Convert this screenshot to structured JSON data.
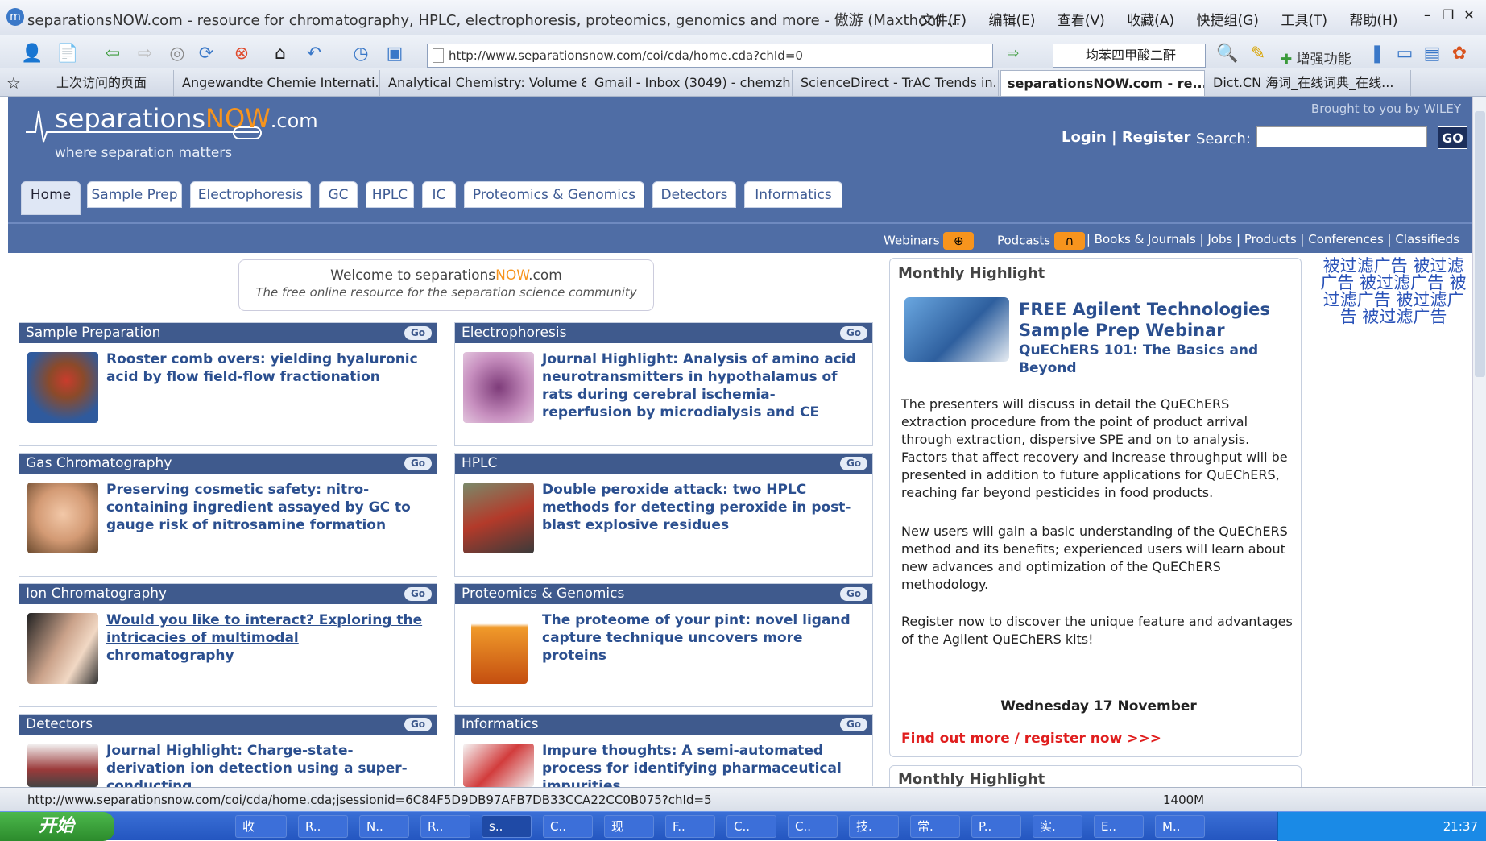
{
  "browser": {
    "title": "separationsNOW.com - resource for chromatography, HPLC, electrophoresis, proteomics, genomics and more - 傲游 (Maxthon) ...",
    "menus": [
      "文件(F)",
      "编辑(E)",
      "查看(V)",
      "收藏(A)",
      "快捷组(G)",
      "工具(T)",
      "帮助(H)"
    ],
    "address": "http://www.separationsnow.com/coi/cda/home.cda?chId=0",
    "search_value": "均苯四甲酸二酐",
    "enhance_label": "增强功能",
    "tabs": [
      "上次访问的页面",
      "Angewandte Chemie Internati...",
      "Analytical Chemistry: Volume 8...",
      "Gmail - Inbox (3049) - chemzh...",
      "ScienceDirect - TrAC Trends in...",
      "separationsNOW.com - re...",
      "Dict.CN 海词_在线词典_在线..."
    ],
    "status_url": "http://www.separationsnow.com/coi/cda/home.cda;jsessionid=6C84F5D9DB97AFB7DB33CCA22CC0B075?chId=5",
    "memory": "1400M"
  },
  "site": {
    "logo_main": "separations",
    "logo_now": "NOW",
    "logo_com": ".com",
    "tagline": "where separation matters",
    "brought": "Brought to you by WILEY",
    "login": "Login | Register",
    "search_label": "Search:",
    "go": "GO",
    "nav": [
      "Home",
      "Sample Prep",
      "Electrophoresis",
      "GC",
      "HPLC",
      "IC",
      "Proteomics & Genomics",
      "Detectors",
      "Informatics"
    ],
    "webinars": "Webinars",
    "podcasts": "Podcasts",
    "sub_links": "| Books & Journals | Jobs | Products | Conferences | Classifieds",
    "welcome_a1": "Welcome to separations",
    "welcome_now": "NOW",
    "welcome_a2": ".com",
    "welcome_b": "The free online resource for the separation science community"
  },
  "boxes": [
    {
      "title": "Sample Preparation",
      "text": "Rooster comb overs: yielding hyaluronic acid by flow field-flow fractionation"
    },
    {
      "title": "Electrophoresis",
      "text": "Journal Highlight: Analysis of amino acid neurotransmitters in hypothalamus of rats during cerebral ischemia-reperfusion by microdialysis and CE"
    },
    {
      "title": "Gas Chromatography",
      "text": "Preserving cosmetic safety: nitro-containing ingredient assayed by GC to gauge risk of nitrosamine formation"
    },
    {
      "title": "HPLC",
      "text": "Double peroxide attack: two HPLC methods for detecting peroxide in post-blast explosive residues"
    },
    {
      "title": "Ion Chromatography",
      "text": "Would you like to interact? Exploring the intricacies of multimodal chromatography"
    },
    {
      "title": "Proteomics & Genomics",
      "text": "The proteome of your pint: novel ligand capture technique uncovers more proteins"
    },
    {
      "title": "Detectors",
      "text": "Journal Highlight: Charge-state-derivation ion detection using a super-conducting"
    },
    {
      "title": "Informatics",
      "text": "Impure thoughts: A semi-automated process for identifying pharmaceutical impurities"
    }
  ],
  "go_label": "Go",
  "highlight": {
    "title": "Monthly Highlight",
    "headline": "FREE Agilent Technologies Sample Prep Webinar",
    "subhead": "QuEChERS 101: The Basics and Beyond",
    "p1": "The presenters will discuss in detail the QuEChERS extraction procedure from the point of product arrival through extraction, dispersive SPE and on to analysis. Factors that affect recovery and increase throughput will be presented in addition to future applications for QuEChERS, reaching far beyond pesticides in food products.",
    "p2": "New users will gain a basic understanding of the QuEChERS method and its benefits; experienced users will learn about new advances and optimization of the QuEChERS methodology.",
    "p3": "Register now to discover the unique feature and advantages of the Agilent QuEChERS kits!",
    "date": "Wednesday 17 November",
    "link": "Find out more / register now >>>",
    "title2": "Monthly Highlight"
  },
  "ad_text": "被过滤广告 被过滤广告 被过滤广告 被过滤广告 被过滤广告 被过滤广告",
  "taskbar": {
    "start": "开始",
    "tasks": [
      "收",
      "R..",
      "N..",
      "R..",
      "s..",
      "C..",
      "现",
      "F..",
      "C..",
      "C..",
      "技.",
      "常.",
      "P..",
      "实.",
      "E..",
      "M.."
    ],
    "clock": "21:37"
  }
}
